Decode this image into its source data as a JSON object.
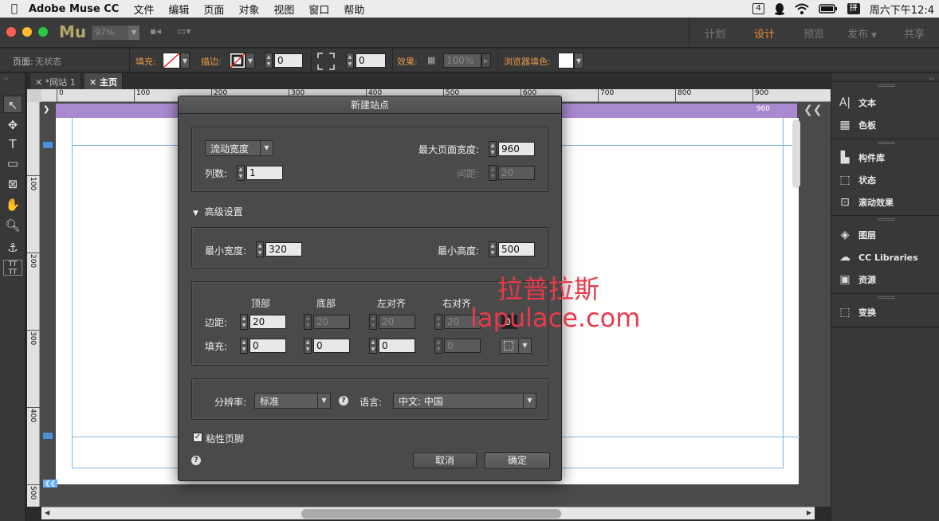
{
  "menubar": {
    "app_name": "Adobe Muse CC",
    "items": [
      "文件",
      "编辑",
      "页面",
      "对象",
      "视图",
      "窗口",
      "帮助"
    ],
    "badge": "4",
    "ime": "拼",
    "clock": "周六下午12:4"
  },
  "appbar": {
    "logo": "Mu",
    "zoom": "97%",
    "modes": [
      "计划",
      "设计",
      "预览",
      "发布",
      "共享"
    ],
    "active_mode": "设计"
  },
  "ctrlbar": {
    "page_label": "页面:",
    "page_state": "无状态",
    "fill_label": "填充:",
    "stroke_label": "描边:",
    "stroke_value": "0",
    "corner_value": "0",
    "effect_label": "效果:",
    "effect_value": "100%",
    "browser_fill_label": "浏览器填色:"
  },
  "tabs": [
    {
      "label": "*网站 1",
      "active": false
    },
    {
      "label": "主页",
      "active": true
    }
  ],
  "ruler_labels": [
    "100",
    "200",
    "300",
    "400",
    "500",
    "600",
    "700",
    "800",
    "900"
  ],
  "vruler_labels": [
    "100",
    "200",
    "300",
    "400",
    "500"
  ],
  "canvas": {
    "header_width": "960"
  },
  "right_panel": {
    "items": [
      {
        "icon": "text-icon",
        "label": "文本"
      },
      {
        "icon": "swatches-icon",
        "label": "色板"
      },
      {
        "icon": "widgets-icon",
        "label": "构件库"
      },
      {
        "icon": "states-icon",
        "label": "状态"
      },
      {
        "icon": "scroll-effects-icon",
        "label": "滚动效果"
      },
      {
        "icon": "layers-icon",
        "label": "图层"
      },
      {
        "icon": "cc-libraries-icon",
        "label": "CC Libraries"
      },
      {
        "icon": "assets-icon",
        "label": "资源"
      },
      {
        "icon": "transform-icon",
        "label": "变换"
      }
    ]
  },
  "dialog": {
    "title": "新建站点",
    "layout_type": "流动宽度",
    "max_width_label": "最大页面宽度:",
    "max_width": "960",
    "columns_label": "列数:",
    "columns": "1",
    "gutter_label": "间距:",
    "gutter": "20",
    "advanced_label": "高级设置",
    "min_width_label": "最小宽度:",
    "min_width": "320",
    "min_height_label": "最小高度:",
    "min_height": "500",
    "col_headers": [
      "顶部",
      "底部",
      "左对齐",
      "右对齐"
    ],
    "margin_label": "边距:",
    "margins": [
      "20",
      "20",
      "20",
      "20"
    ],
    "padding_label": "填充:",
    "paddings": [
      "0",
      "0",
      "0",
      "0"
    ],
    "link_value": "0",
    "resolution_label": "分辨率:",
    "resolution": "标准",
    "language_label": "语言:",
    "language": "中文: 中国",
    "sticky_footer_label": "粘性页脚",
    "sticky_footer_checked": true,
    "cancel_label": "取消",
    "ok_label": "确定"
  },
  "watermark": {
    "line1": "拉普拉斯",
    "line2": "lapulace.com"
  }
}
